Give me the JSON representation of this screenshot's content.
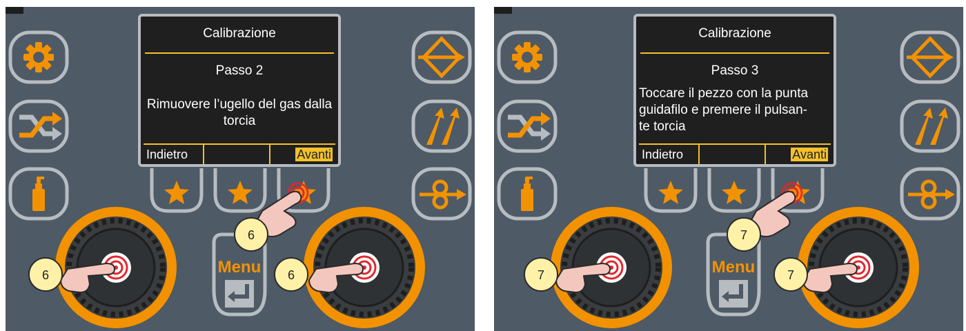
{
  "colors": {
    "panel_bg": "#4e5a66",
    "accent": "#f39200",
    "button_frame": "#b7bcc1",
    "screen_bg": "#1f1f1f",
    "highlight_yellow": "#f3c12a",
    "badge_fill": "#fff2a8"
  },
  "icons": {
    "left_column": [
      "gear-icon",
      "shuffle-icon",
      "spray-can-icon"
    ],
    "right_column": [
      "arrows-diamond-icon",
      "slash-arrows-icon",
      "wire-feed-icon"
    ],
    "softkeys": [
      "star-icon",
      "star-icon",
      "star-icon"
    ],
    "hand": "pointing-hand-icon"
  },
  "panels": [
    {
      "screen": {
        "title": "Calibrazione",
        "step": "Passo 2",
        "message": "Rimuovere l’ugello del gas dalla torcia",
        "softkey_back": "Indietro",
        "softkey_middle": "",
        "softkey_forward": "Avanti"
      },
      "menu_label": "Menu",
      "badges": {
        "left_knob": "6",
        "softkey": "6",
        "right_knob": "6"
      }
    },
    {
      "screen": {
        "title": "Calibrazione",
        "step": "Passo 3",
        "message_lines": [
          "Toccare il pezzo con la punta",
          "guidafilo e premere il pulsan-",
          "te torcia"
        ],
        "softkey_back": "Indietro",
        "softkey_middle": "",
        "softkey_forward": "Avanti"
      },
      "menu_label": "Menu",
      "badges": {
        "left_knob": "7",
        "softkey": "7",
        "right_knob": "7"
      }
    }
  ]
}
